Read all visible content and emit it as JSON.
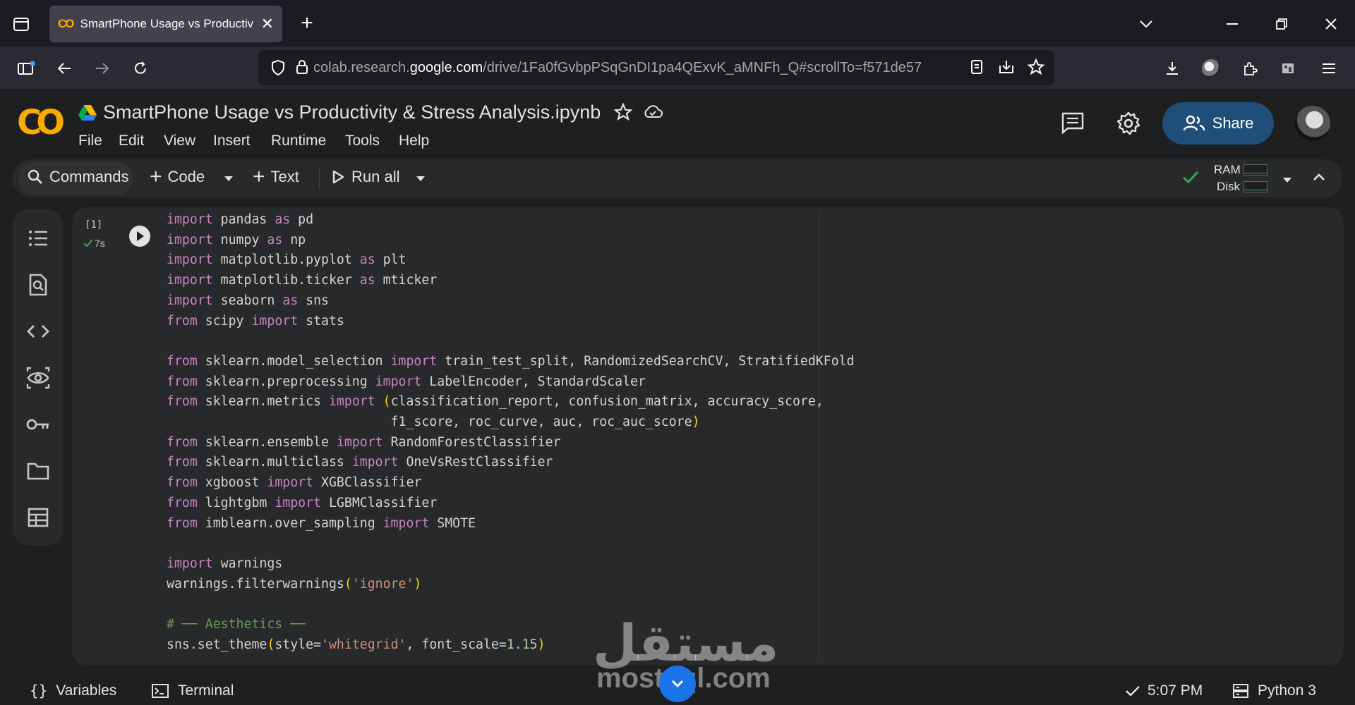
{
  "browser": {
    "tab_title": "SmartPhone Usage vs Productiv",
    "tab_icon": "CO",
    "new_tab": "+",
    "close_tab": "✕",
    "url_prefix": "colab.research.",
    "url_host": "google.com",
    "url_path": "/drive/1Fa0fGvbpPSqGnDI1pa4QExvK_aMNFh_Q#scrollTo=f571de57"
  },
  "colab": {
    "logo": "CO",
    "notebook_title": "SmartPhone Usage vs Productivity & Stress Analysis.ipynb",
    "menu": [
      "File",
      "Edit",
      "View",
      "Insert",
      "Runtime",
      "Tools",
      "Help"
    ],
    "share_label": "Share"
  },
  "toolbar": {
    "commands": "Commands",
    "code": "Code",
    "text": "Text",
    "run_all": "Run all",
    "ram": "RAM",
    "disk": "Disk"
  },
  "cell": {
    "exec_count": "[1]",
    "exec_time": "7s"
  },
  "statusbar": {
    "variables": "Variables",
    "terminal": "Terminal",
    "time": "5:07 PM",
    "runtime": "Python 3"
  },
  "watermark": {
    "arabic": "مستقل",
    "latin": "mostaql.com"
  },
  "colors": {
    "accent": "#f9ab00",
    "share_bg": "#1f4e79",
    "ok_check": "#34a853"
  }
}
